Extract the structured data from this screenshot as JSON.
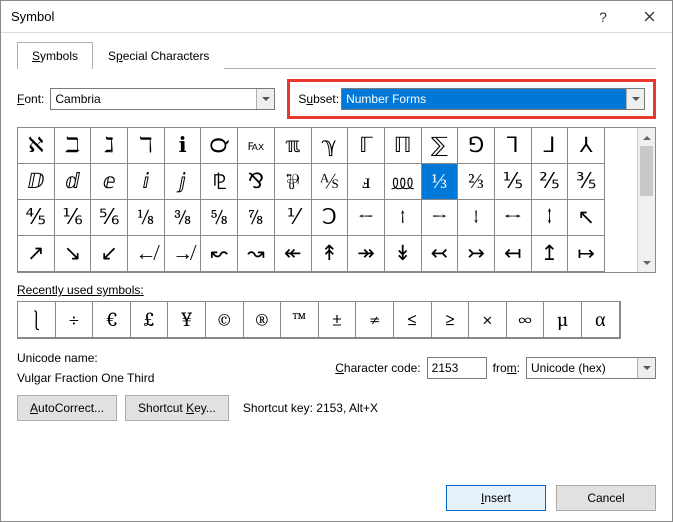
{
  "title": "Symbol",
  "tabs": {
    "symbols": "Symbols",
    "special": "Special Characters"
  },
  "labels": {
    "font": "Font:",
    "subset": "Subset:",
    "recent": "Recently used symbols:",
    "unicode_name": "Unicode name:",
    "char_code": "Character code:",
    "from": "from:",
    "shortcut_prefix": "Shortcut key:"
  },
  "font_value": "Cambria",
  "subset_value": "Number Forms",
  "grid": [
    [
      "ℵ",
      "ℶ",
      "ℷ",
      "ℸ",
      "ℹ",
      "℺",
      "℻",
      "ℼ",
      "ℽ",
      "ℾ",
      "ℿ",
      "⅀",
      "⅁",
      "⅂",
      "⅃",
      "⅄"
    ],
    [
      "ⅅ",
      "ⅆ",
      "ⅇ",
      "ⅈ",
      "ⅉ",
      "⅊",
      "⅋",
      "⅌",
      "⅍",
      "ⅎ",
      "⅏",
      "⅓",
      "⅔",
      "⅕",
      "⅖",
      "⅗"
    ],
    [
      "⅘",
      "⅙",
      "⅚",
      "⅛",
      "⅜",
      "⅝",
      "⅞",
      "⅟",
      "Ↄ",
      "←",
      "↑",
      "→",
      "↓",
      "↔",
      "↕",
      "↖"
    ],
    [
      "↗",
      "↘",
      "↙",
      "↚",
      "↛",
      "↜",
      "↝",
      "↞",
      "↟",
      "↠",
      "↡",
      "↢",
      "↣",
      "↤",
      "↥",
      "↦"
    ]
  ],
  "selected": {
    "row": 1,
    "col": 11
  },
  "recent": [
    "⎱",
    "÷",
    "€",
    "£",
    "¥",
    "©",
    "®",
    "™",
    "±",
    "≠",
    "≤",
    "≥",
    "×",
    "∞",
    "µ",
    "α"
  ],
  "unicode_name_value": "Vulgar Fraction One Third",
  "char_code_value": "2153",
  "from_value": "Unicode (hex)",
  "shortcut_value": "2153, Alt+X",
  "buttons": {
    "autocorrect": "AutoCorrect...",
    "shortcut_key": "Shortcut Key...",
    "insert": "Insert",
    "cancel": "Cancel"
  }
}
